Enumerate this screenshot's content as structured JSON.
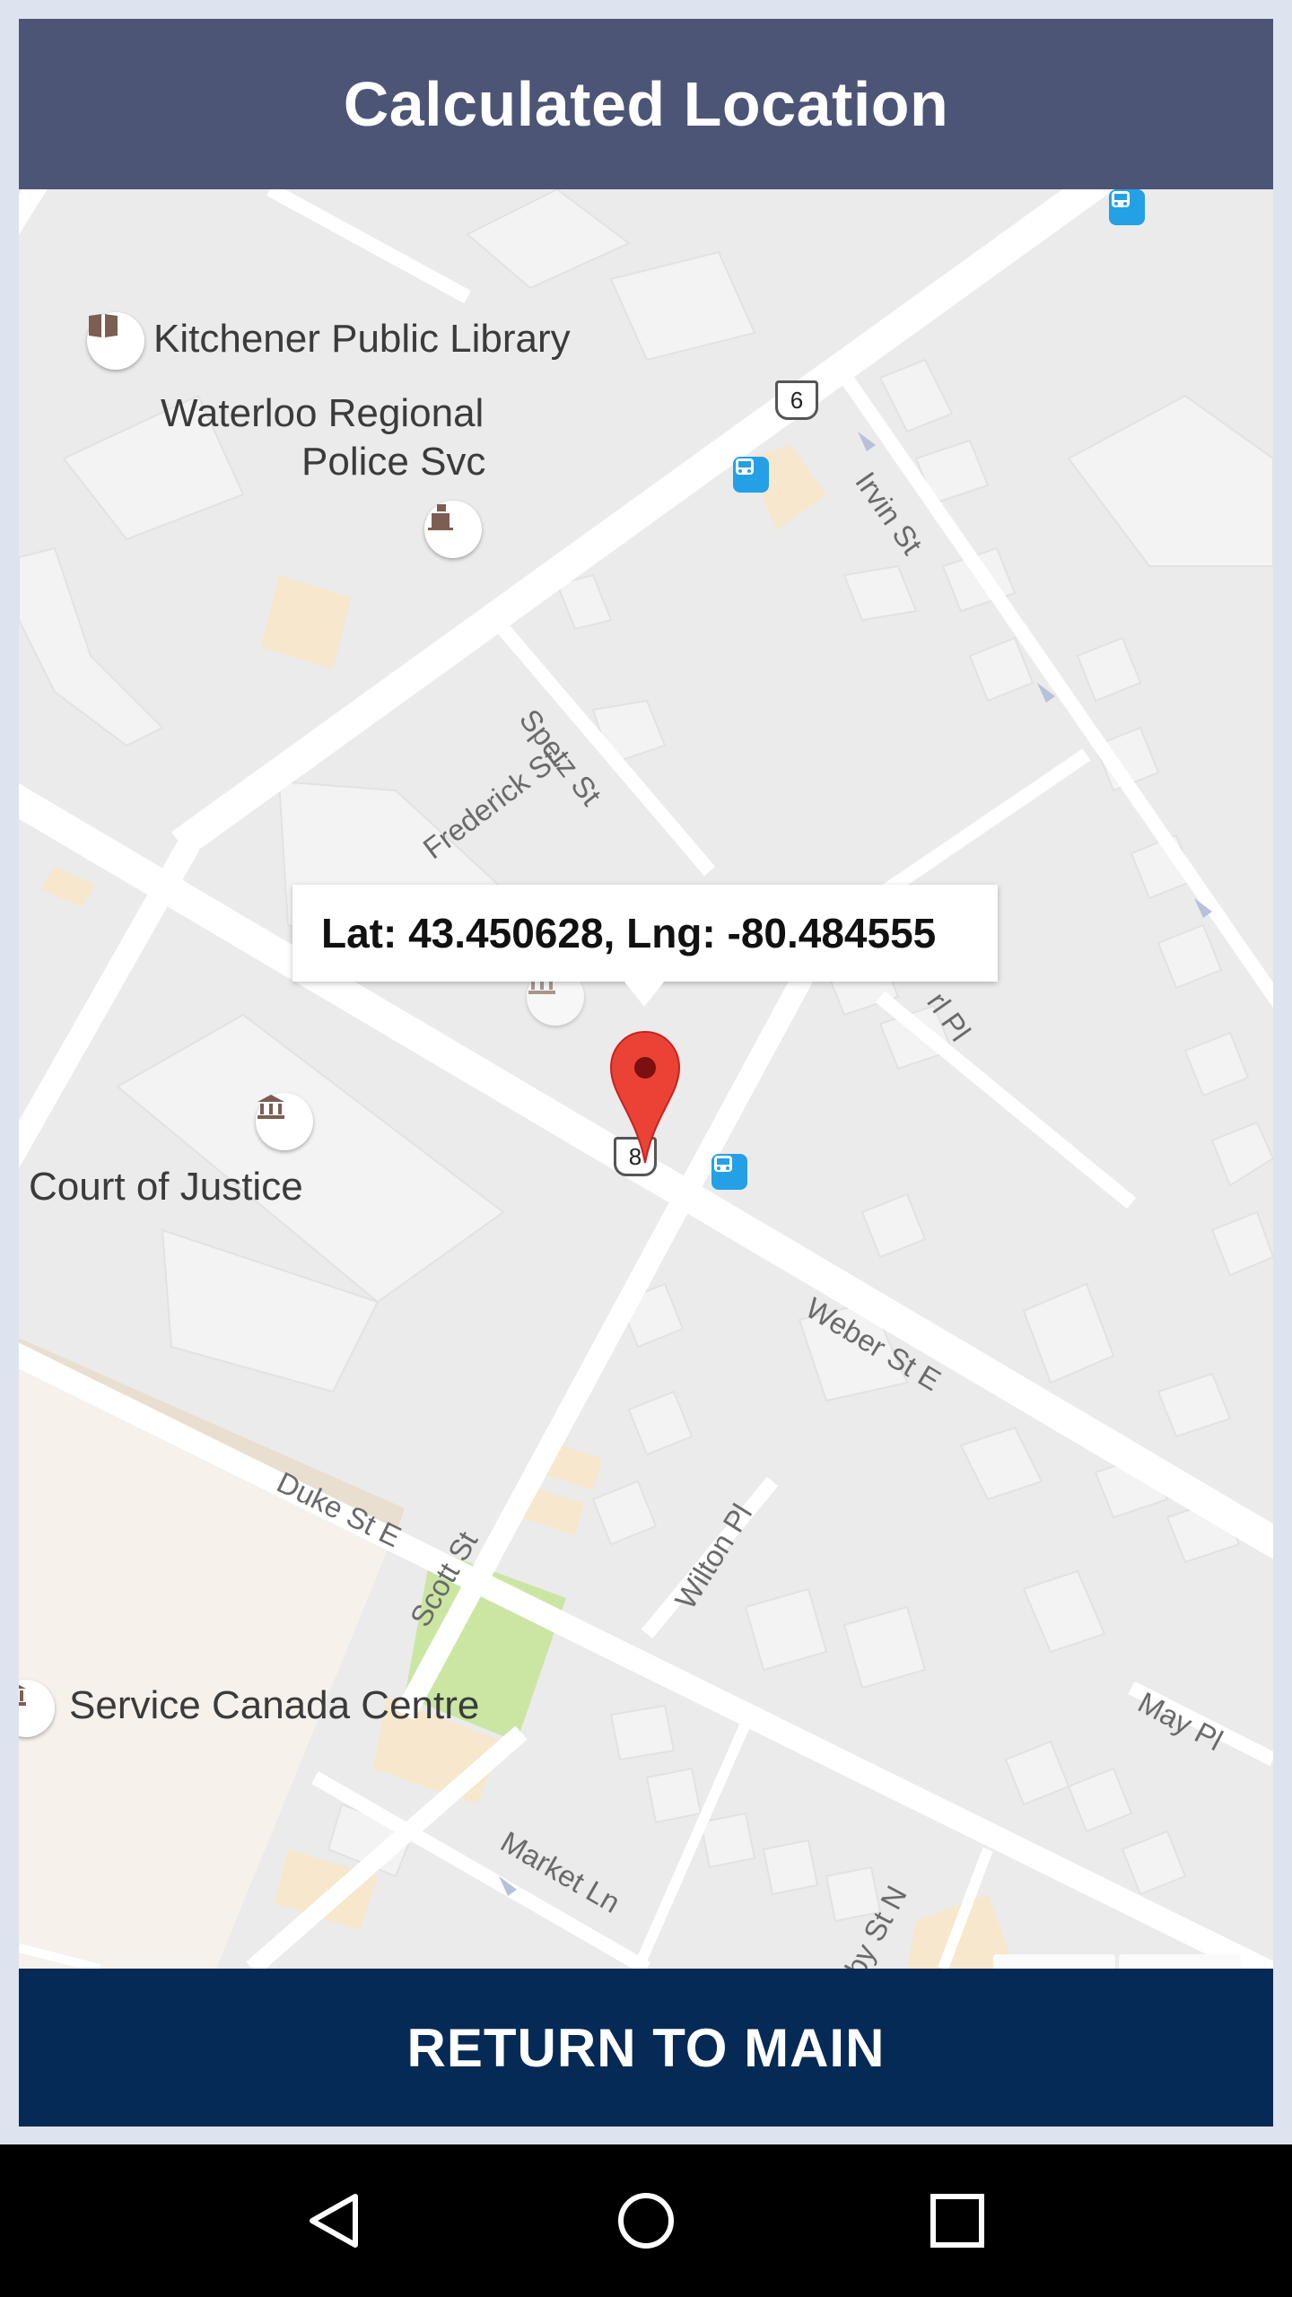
{
  "header": {
    "title": "Calculated Location"
  },
  "info_window": {
    "text": "Lat: 43.450628, Lng: -80.484555"
  },
  "map": {
    "places": {
      "library": "Kitchener Public Library",
      "police_line1": "Waterloo Regional",
      "police_line2": "Police Svc",
      "court": "Court of Justice",
      "service_canada": "Service Canada Centre"
    },
    "streets": {
      "frederick": "Frederick St",
      "spetz": "Spetz St",
      "irvin": "Irvin St",
      "weber": "Weber St E",
      "duke": "Duke St E",
      "scott": "Scott St",
      "wilton": "Wilton Pl",
      "may": "May Pl",
      "market": "Market Ln",
      "partial_pl": "rl Pl",
      "partial_st": "by St N"
    },
    "route_shields": {
      "top": "6",
      "marker": "8"
    },
    "colors": {
      "land": "#ebebeb",
      "road": "#ffffff",
      "park": "#cbe6a3",
      "marker": "#ea4335"
    }
  },
  "footer": {
    "return_label": "RETURN TO MAIN"
  },
  "system_nav": {
    "back": "back-icon",
    "home": "home-icon",
    "recents": "recents-icon"
  }
}
